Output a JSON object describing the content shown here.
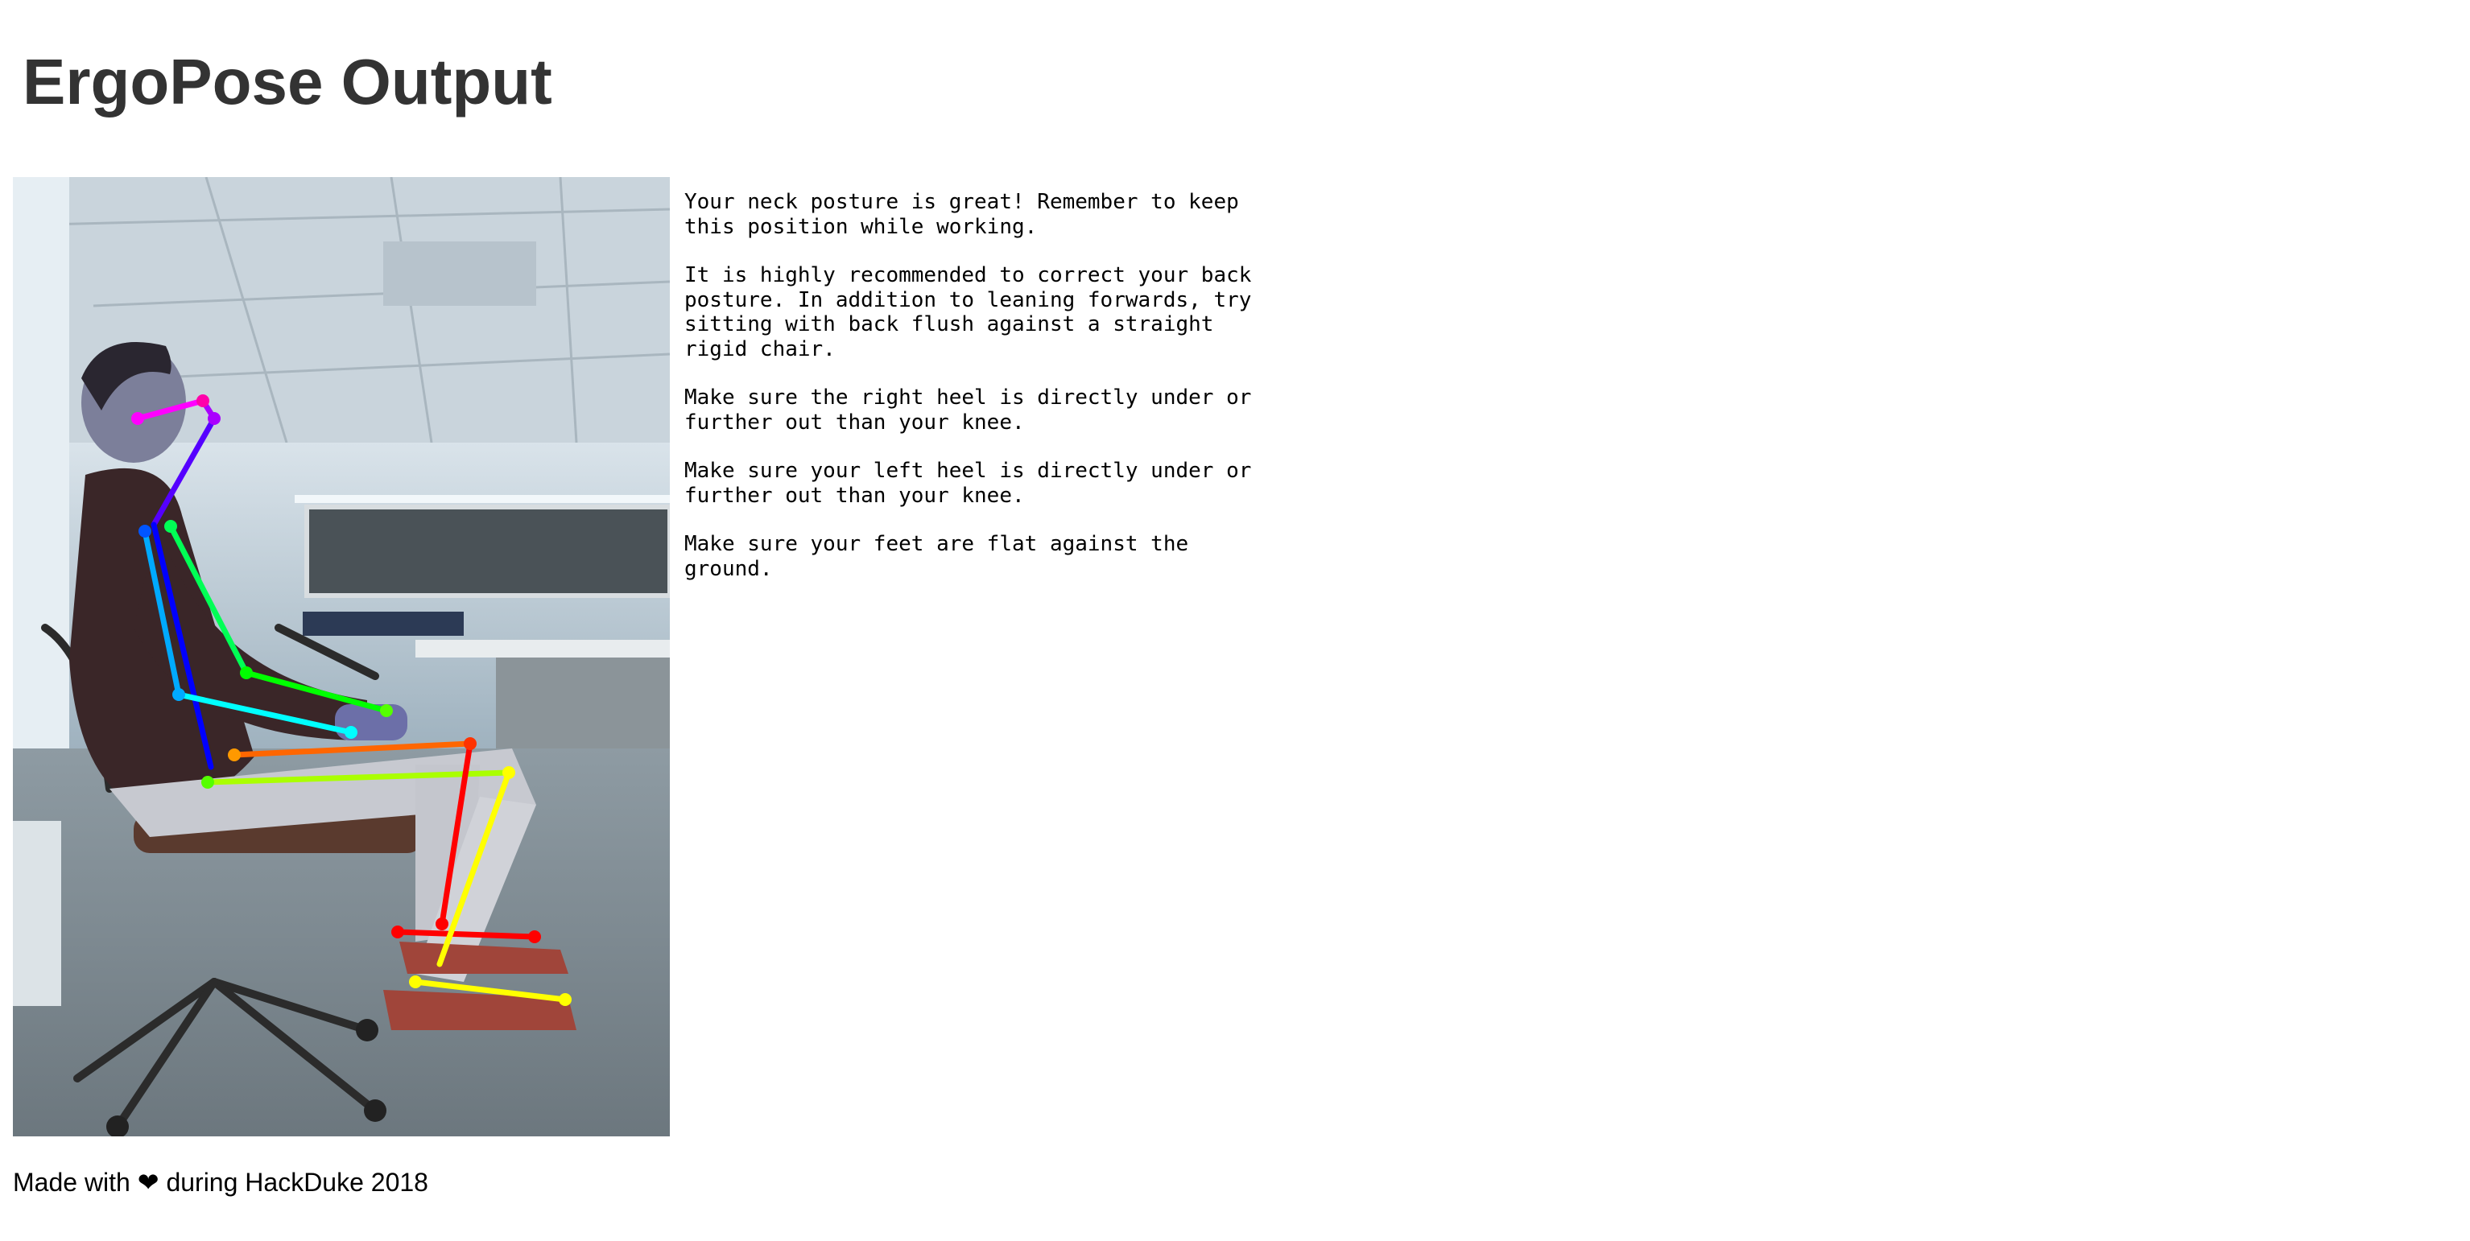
{
  "page": {
    "title": "ErgoPose Output"
  },
  "photo": {
    "description_icon": "pose-photo",
    "skeleton_colors": {
      "head": "#ff00ff",
      "neck": "#5500ff",
      "spine": "#0000ff",
      "right_arm": "#00aaff",
      "left_arm": "#00ff55",
      "right_leg": "#ff0000",
      "left_leg": "#ffff00",
      "hip": "#aaff00",
      "hip_right": "#ff6600"
    }
  },
  "feedback": {
    "items": [
      "Your neck posture is great! Remember to keep this position while working.",
      "It is highly recommended to correct your back posture. In addition to leaning forwards, try sitting with back flush against a straight rigid chair.",
      "Make sure the right heel is directly under or further out than your knee.",
      "Make sure your left heel is directly under or further out than your knee.",
      "Make sure your feet are flat against the ground."
    ]
  },
  "footer": {
    "prefix": "Made with",
    "heart": "❤",
    "suffix": "during HackDuke 2018"
  }
}
